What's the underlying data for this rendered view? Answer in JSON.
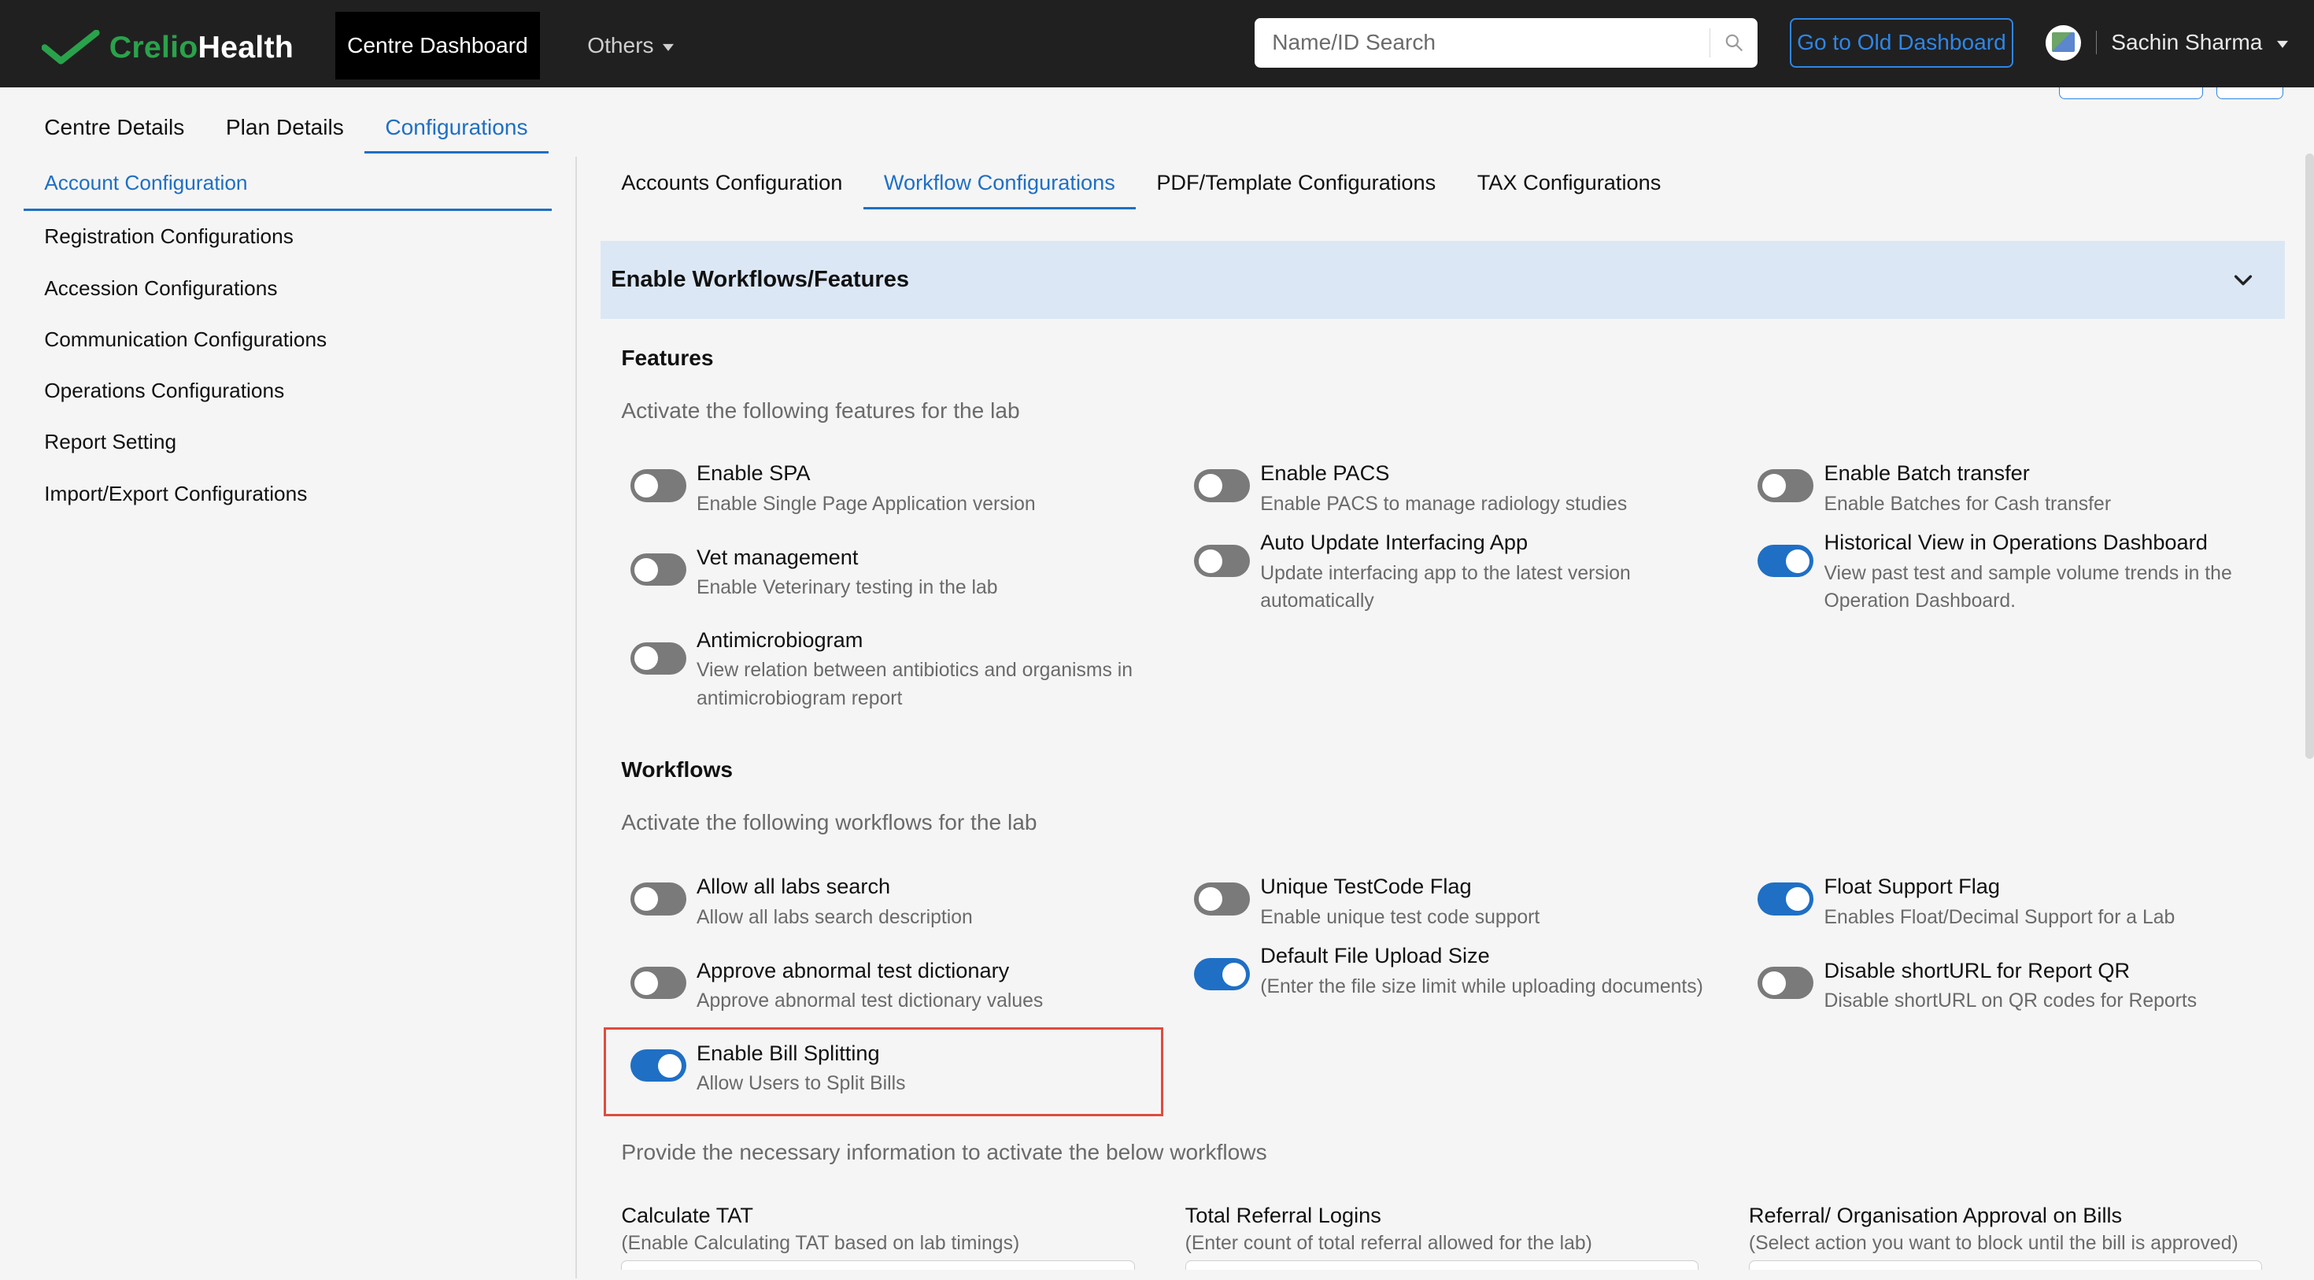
{
  "topbar": {
    "brand": {
      "part1": "Crelio",
      "part2": "Health"
    },
    "active_nav": "Centre Dashboard",
    "others_label": "Others",
    "search_placeholder": "Name/ID Search",
    "old_dashboard_label": "Go to Old Dashboard",
    "user_name": "Sachin Sharma"
  },
  "page_tabs": [
    {
      "label": "Centre Details"
    },
    {
      "label": "Plan Details"
    },
    {
      "label": "Configurations"
    }
  ],
  "sidebar": {
    "items": [
      {
        "label": "Account Configuration"
      },
      {
        "label": "Registration Configurations"
      },
      {
        "label": "Accession Configurations"
      },
      {
        "label": "Communication Configurations"
      },
      {
        "label": "Operations Configurations"
      },
      {
        "label": "Report Setting"
      },
      {
        "label": "Import/Export Configurations"
      }
    ]
  },
  "config_tabs": [
    {
      "label": "Accounts Configuration"
    },
    {
      "label": "Workflow Configurations"
    },
    {
      "label": "PDF/Template Configurations"
    },
    {
      "label": "TAX Configurations"
    }
  ],
  "band": {
    "title": "Enable Workflows/Features"
  },
  "features": {
    "title": "Features",
    "subtitle": "Activate the following features for the lab",
    "items": [
      {
        "label": "Enable SPA",
        "desc": "Enable Single Page Application version",
        "enabled": false
      },
      {
        "label": "Enable PACS",
        "desc": "Enable PACS to manage radiology studies",
        "enabled": false
      },
      {
        "label": "Enable Batch transfer",
        "desc": "Enable Batches for Cash transfer",
        "enabled": false
      },
      {
        "label": "Vet management",
        "desc": "Enable Veterinary testing in the lab",
        "enabled": false
      },
      {
        "label": "Auto Update Interfacing App",
        "desc": "Update interfacing app to the latest version automatically",
        "enabled": false
      },
      {
        "label": "Historical View in Operations Dashboard",
        "desc": "View past test and sample volume trends in the Operation Dashboard.",
        "enabled": true
      },
      {
        "label": "Antimicrobiogram",
        "desc": "View relation between antibiotics and organisms in antimicrobiogram report",
        "enabled": false
      }
    ]
  },
  "workflows": {
    "title": "Workflows",
    "subtitle": "Activate the following workflows for the lab",
    "items": [
      {
        "label": "Allow all labs search",
        "desc": "Allow all labs search description",
        "enabled": false
      },
      {
        "label": "Unique TestCode Flag",
        "desc": "Enable unique test code support",
        "enabled": false
      },
      {
        "label": "Float Support Flag",
        "desc": "Enables Float/Decimal Support for a Lab",
        "enabled": true
      },
      {
        "label": "Approve abnormal test dictionary",
        "desc": "Approve abnormal test dictionary values",
        "enabled": false
      },
      {
        "label": "Default File Upload Size",
        "desc": "(Enter the file size limit while uploading documents)",
        "enabled": true
      },
      {
        "label": "Disable shortURL for Report QR",
        "desc": "Disable shortURL on QR codes for Reports",
        "enabled": false
      },
      {
        "label": "Enable Bill Splitting",
        "desc": "Allow Users to Split Bills",
        "enabled": true
      }
    ]
  },
  "bottom": {
    "info": "Provide the necessary information to activate the below workflows",
    "items": [
      {
        "title": "Calculate TAT",
        "desc": "(Enable Calculating TAT based on lab timings)"
      },
      {
        "title": "Total Referral Logins",
        "desc": "(Enter count of total referral allowed for the lab)"
      },
      {
        "title": "Referral/ Organisation Approval on Bills",
        "desc": "(Select action you want to block until the bill is approved)"
      }
    ]
  },
  "colors": {
    "accent": "#1f6fc5",
    "topbar": "#202020",
    "band": "#dbe7f5",
    "toggle_off": "#7a7a7a",
    "highlight": "#e04b3f"
  }
}
